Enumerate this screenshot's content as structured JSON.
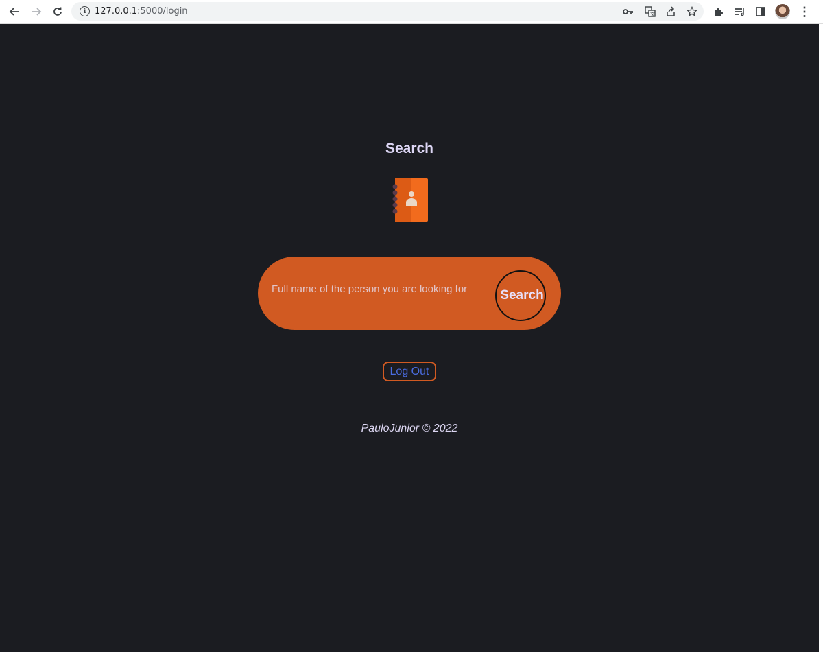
{
  "browser": {
    "url_host": "127.0.0.1",
    "url_path": ":5000/login",
    "icons": {
      "back": "arrow-left-icon",
      "forward": "arrow-right-icon",
      "reload": "reload-icon",
      "site_info": "info-icon",
      "password": "key-icon",
      "translate": "translate-icon",
      "share": "share-icon",
      "bookmark": "star-icon",
      "extensions": "puzzle-icon",
      "reading_list": "reading-list-icon",
      "side_panel": "side-panel-icon",
      "profile": "avatar",
      "menu": "kebab-menu-icon"
    }
  },
  "page": {
    "title": "Search",
    "search": {
      "placeholder": "Full name of the person you are looking for",
      "button_label": "Search"
    },
    "logout_label": "Log Out",
    "footer": "PauloJunior © 2022"
  },
  "colors": {
    "background": "#1b1c21",
    "accent": "#d15a22",
    "title": "#ddd6f5",
    "link": "#4a6ce0"
  }
}
